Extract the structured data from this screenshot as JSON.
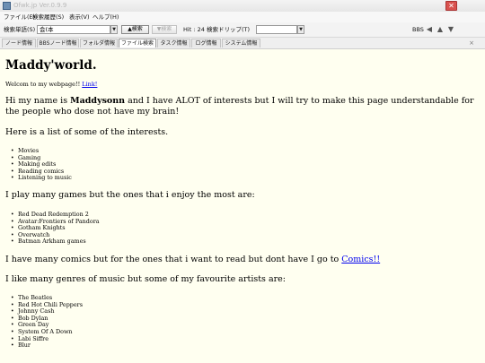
{
  "window": {
    "title": "Ofwk.jp Ver.0.9.9",
    "close_glyph": "✕",
    "minimize_glyph": "—",
    "maximize_glyph": "☐"
  },
  "menu": {
    "items": [
      "ファイル(E)",
      "検索履歴(S)",
      "表示(V)",
      "ヘルプ(H)"
    ]
  },
  "toolbar": {
    "search_label": "検索単語(S)",
    "search_value": "会(本",
    "search_button": "▲検索",
    "search_next_button": "▼検索",
    "hit_count": "Hit : 24",
    "filter_label": "検索ドリップ(T)",
    "filter_value": "",
    "bbs_label": "BBS",
    "nav_left_icon": "arrow-left-icon",
    "nav_up_icon": "arrow-up-icon",
    "nav_down_icon": "arrow-down-icon"
  },
  "tabs": {
    "items": [
      "ノード情報",
      "BBSノード情報",
      "フォルダ情報",
      "ファイル検索",
      "タスク情報",
      "ログ情報",
      "システム情報"
    ],
    "active_index": 3,
    "close_glyph": "×"
  },
  "page": {
    "heading": "Maddy'world.",
    "welcome_text": "Welcom to my webpage!! ",
    "welcome_link": "Link!",
    "intro_pre": "Hi my name is ",
    "intro_name": "Maddysonn",
    "intro_post": " and I have ALOT of interests but I will try to make this page understandable for the people who dose not have my brain!",
    "interests_heading": "Here is a list of some of the interests.",
    "interests": [
      "Movies",
      "Gaming",
      "Making edits",
      "Reading comics",
      "Listening to music"
    ],
    "games_heading": "I play many games but the ones that i enjoy the most are:",
    "games": [
      "Red Dead Redemption 2",
      "Avatar:Frontiers of Pandora",
      "Gotham Knights",
      "Overwatch",
      "Batman Arkham games"
    ],
    "comics_text": "I have many comics but for the ones that i want to read but dont have I go to ",
    "comics_link": "Comics!!",
    "music_heading": "I like many genres of music but some of my favourite artists are:",
    "artists": [
      "The Beatles",
      "Red Hot Chili Peppers",
      "Johnny Cash",
      "Bob Dylan",
      "Green Day",
      "System Of A Down",
      "Labi Siffre",
      "Blur"
    ]
  }
}
